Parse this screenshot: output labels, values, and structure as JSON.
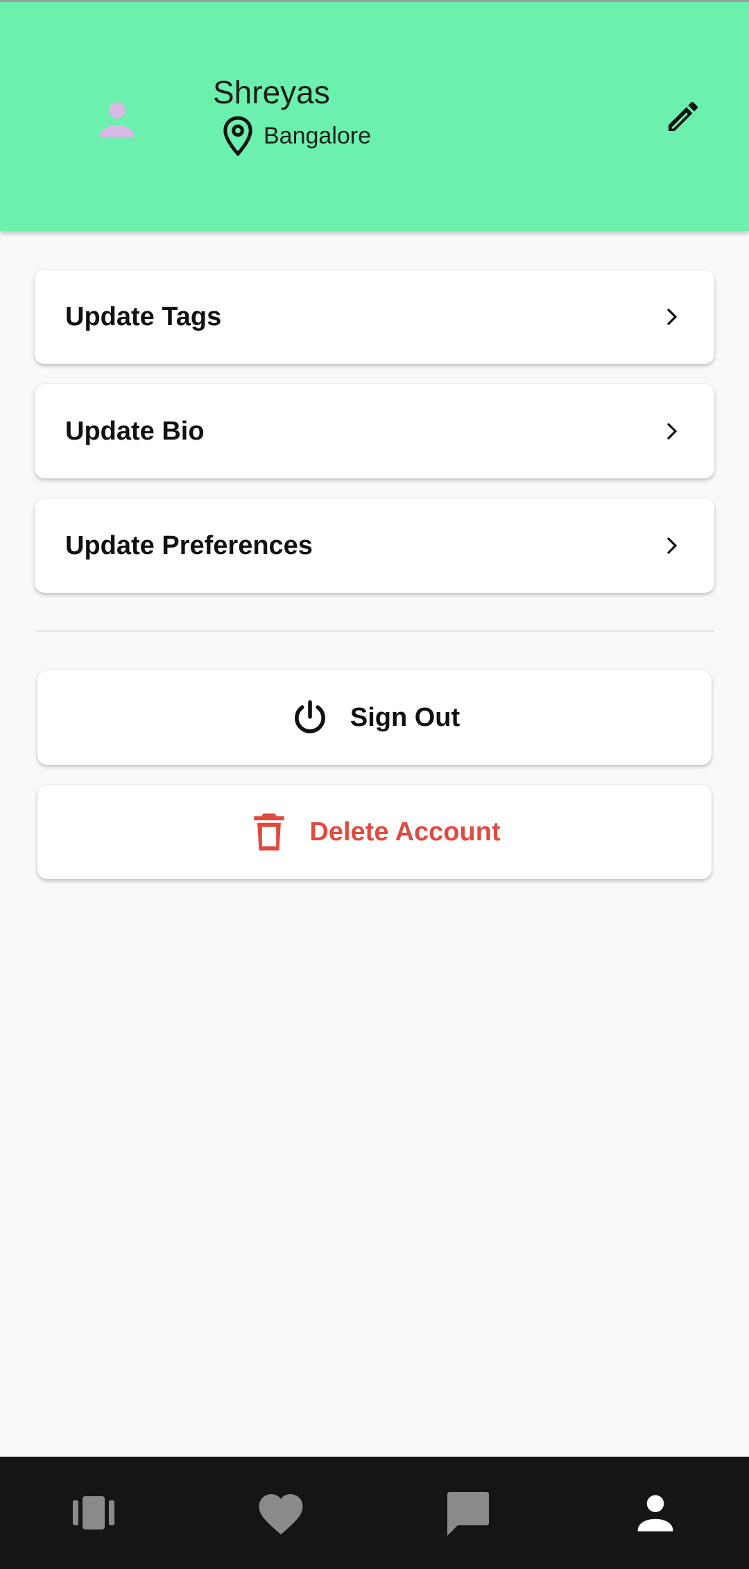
{
  "header": {
    "user_name": "Shreyas",
    "location": "Bangalore",
    "background_color": "#6bf1ad",
    "avatar_icon": "person-icon",
    "edit_icon": "pencil-icon"
  },
  "menu": {
    "items": [
      {
        "label": "Update Tags",
        "icon": "chevron-right-icon"
      },
      {
        "label": "Update Bio",
        "icon": "chevron-right-icon"
      },
      {
        "label": "Update Preferences",
        "icon": "chevron-right-icon"
      }
    ]
  },
  "actions": {
    "sign_out": {
      "label": "Sign Out",
      "icon": "power-icon",
      "color": "#111111"
    },
    "delete_account": {
      "label": "Delete Account",
      "icon": "trash-icon",
      "color": "#e04a3f"
    }
  },
  "bottom_nav": {
    "items": [
      {
        "icon": "cards-carousel-icon",
        "active": false
      },
      {
        "icon": "heart-icon",
        "active": false
      },
      {
        "icon": "chat-icon",
        "active": false
      },
      {
        "icon": "person-icon",
        "active": true
      }
    ],
    "active_color": "#ffffff",
    "inactive_color": "#8a8a8a"
  }
}
